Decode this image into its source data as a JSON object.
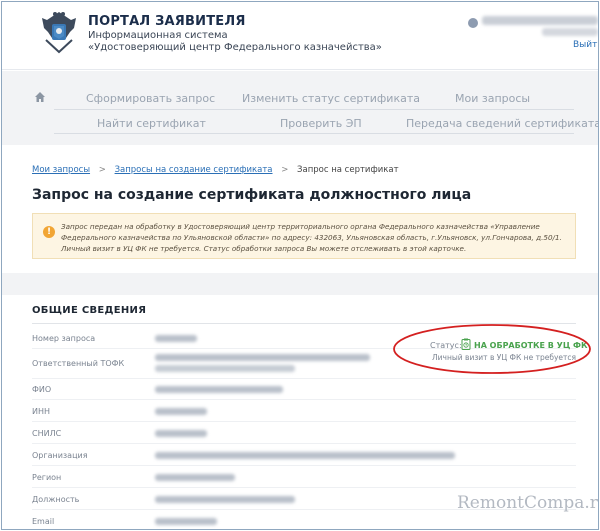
{
  "header": {
    "title": "ПОРТАЛ ЗАЯВИТЕЛЯ",
    "subtitle_line1": "Информационная система",
    "subtitle_line2": "«Удостоверяющий центр Федерального казначейства»",
    "logout": "Выйти"
  },
  "nav": {
    "row1": [
      "Сформировать запрос",
      "Изменить статус сертификата",
      "Мои запросы"
    ],
    "row2": [
      "Найти сертификат",
      "Проверить ЭП",
      "Передача сведений сертификата"
    ]
  },
  "breadcrumb": {
    "items": [
      "Мои запросы",
      "Запросы на создание сертификата",
      "Запрос на сертификат"
    ],
    "separator": ">"
  },
  "page_title": "Запрос на создание сертификата должностного лица",
  "notice": {
    "icon": "!",
    "text": "Запрос передан на обработку в Удостоверяющий центр территориального органа Федерального казначейства «Управление Федерального казначейства по Ульяновской области» по адресу: 432063, Ульяновская область, г.Ульяновск, ул.Гончарова, д.50/1. Личный визит в УЦ ФК не требуется. Статус обработки запроса Вы можете отслеживать в этой карточке."
  },
  "general": {
    "section_title": "ОБЩИЕ СВЕДЕНИЯ",
    "fields": [
      "Номер запроса",
      "Ответственный ТОФК",
      "ФИО",
      "ИНН",
      "СНИЛС",
      "Организация",
      "Регион",
      "Должность",
      "Email"
    ]
  },
  "status": {
    "label": "Статус:",
    "value": "НА ОБРАБОТКЕ В УЦ ФК",
    "note": "Личный визит в УЦ ФК не требуется"
  },
  "watermark": "RemontCompa.ru",
  "colors": {
    "status_green": "#49a24d",
    "link_blue": "#2a6fb6",
    "annotation_red": "#d42020",
    "notice_bg": "#fdf5e3"
  }
}
